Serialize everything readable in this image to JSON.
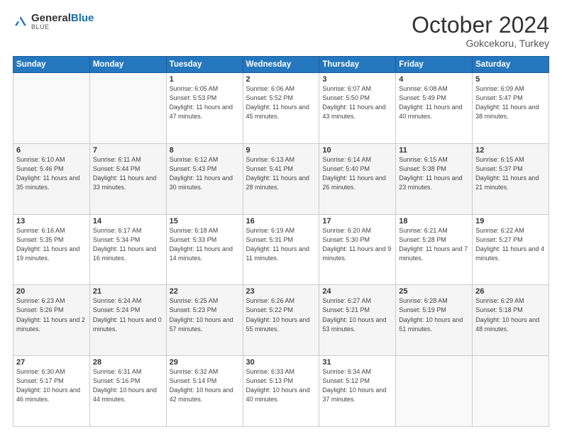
{
  "logo": {
    "general": "General",
    "blue": "Blue"
  },
  "header": {
    "month": "October 2024",
    "location": "Gokcekoru, Turkey"
  },
  "weekdays": [
    "Sunday",
    "Monday",
    "Tuesday",
    "Wednesday",
    "Thursday",
    "Friday",
    "Saturday"
  ],
  "weeks": [
    [
      {
        "day": "",
        "sunrise": "",
        "sunset": "",
        "daylight": ""
      },
      {
        "day": "",
        "sunrise": "",
        "sunset": "",
        "daylight": ""
      },
      {
        "day": "1",
        "sunrise": "Sunrise: 6:05 AM",
        "sunset": "Sunset: 5:53 PM",
        "daylight": "Daylight: 11 hours and 47 minutes."
      },
      {
        "day": "2",
        "sunrise": "Sunrise: 6:06 AM",
        "sunset": "Sunset: 5:52 PM",
        "daylight": "Daylight: 11 hours and 45 minutes."
      },
      {
        "day": "3",
        "sunrise": "Sunrise: 6:07 AM",
        "sunset": "Sunset: 5:50 PM",
        "daylight": "Daylight: 11 hours and 43 minutes."
      },
      {
        "day": "4",
        "sunrise": "Sunrise: 6:08 AM",
        "sunset": "Sunset: 5:49 PM",
        "daylight": "Daylight: 11 hours and 40 minutes."
      },
      {
        "day": "5",
        "sunrise": "Sunrise: 6:09 AM",
        "sunset": "Sunset: 5:47 PM",
        "daylight": "Daylight: 11 hours and 38 minutes."
      }
    ],
    [
      {
        "day": "6",
        "sunrise": "Sunrise: 6:10 AM",
        "sunset": "Sunset: 5:46 PM",
        "daylight": "Daylight: 11 hours and 35 minutes."
      },
      {
        "day": "7",
        "sunrise": "Sunrise: 6:11 AM",
        "sunset": "Sunset: 5:44 PM",
        "daylight": "Daylight: 11 hours and 33 minutes."
      },
      {
        "day": "8",
        "sunrise": "Sunrise: 6:12 AM",
        "sunset": "Sunset: 5:43 PM",
        "daylight": "Daylight: 11 hours and 30 minutes."
      },
      {
        "day": "9",
        "sunrise": "Sunrise: 6:13 AM",
        "sunset": "Sunset: 5:41 PM",
        "daylight": "Daylight: 11 hours and 28 minutes."
      },
      {
        "day": "10",
        "sunrise": "Sunrise: 6:14 AM",
        "sunset": "Sunset: 5:40 PM",
        "daylight": "Daylight: 11 hours and 26 minutes."
      },
      {
        "day": "11",
        "sunrise": "Sunrise: 6:15 AM",
        "sunset": "Sunset: 5:38 PM",
        "daylight": "Daylight: 11 hours and 23 minutes."
      },
      {
        "day": "12",
        "sunrise": "Sunrise: 6:15 AM",
        "sunset": "Sunset: 5:37 PM",
        "daylight": "Daylight: 11 hours and 21 minutes."
      }
    ],
    [
      {
        "day": "13",
        "sunrise": "Sunrise: 6:16 AM",
        "sunset": "Sunset: 5:35 PM",
        "daylight": "Daylight: 11 hours and 19 minutes."
      },
      {
        "day": "14",
        "sunrise": "Sunrise: 6:17 AM",
        "sunset": "Sunset: 5:34 PM",
        "daylight": "Daylight: 11 hours and 16 minutes."
      },
      {
        "day": "15",
        "sunrise": "Sunrise: 6:18 AM",
        "sunset": "Sunset: 5:33 PM",
        "daylight": "Daylight: 11 hours and 14 minutes."
      },
      {
        "day": "16",
        "sunrise": "Sunrise: 6:19 AM",
        "sunset": "Sunset: 5:31 PM",
        "daylight": "Daylight: 11 hours and 11 minutes."
      },
      {
        "day": "17",
        "sunrise": "Sunrise: 6:20 AM",
        "sunset": "Sunset: 5:30 PM",
        "daylight": "Daylight: 11 hours and 9 minutes."
      },
      {
        "day": "18",
        "sunrise": "Sunrise: 6:21 AM",
        "sunset": "Sunset: 5:28 PM",
        "daylight": "Daylight: 11 hours and 7 minutes."
      },
      {
        "day": "19",
        "sunrise": "Sunrise: 6:22 AM",
        "sunset": "Sunset: 5:27 PM",
        "daylight": "Daylight: 11 hours and 4 minutes."
      }
    ],
    [
      {
        "day": "20",
        "sunrise": "Sunrise: 6:23 AM",
        "sunset": "Sunset: 5:26 PM",
        "daylight": "Daylight: 11 hours and 2 minutes."
      },
      {
        "day": "21",
        "sunrise": "Sunrise: 6:24 AM",
        "sunset": "Sunset: 5:24 PM",
        "daylight": "Daylight: 11 hours and 0 minutes."
      },
      {
        "day": "22",
        "sunrise": "Sunrise: 6:25 AM",
        "sunset": "Sunset: 5:23 PM",
        "daylight": "Daylight: 10 hours and 57 minutes."
      },
      {
        "day": "23",
        "sunrise": "Sunrise: 6:26 AM",
        "sunset": "Sunset: 5:22 PM",
        "daylight": "Daylight: 10 hours and 55 minutes."
      },
      {
        "day": "24",
        "sunrise": "Sunrise: 6:27 AM",
        "sunset": "Sunset: 5:21 PM",
        "daylight": "Daylight: 10 hours and 53 minutes."
      },
      {
        "day": "25",
        "sunrise": "Sunrise: 6:28 AM",
        "sunset": "Sunset: 5:19 PM",
        "daylight": "Daylight: 10 hours and 51 minutes."
      },
      {
        "day": "26",
        "sunrise": "Sunrise: 6:29 AM",
        "sunset": "Sunset: 5:18 PM",
        "daylight": "Daylight: 10 hours and 48 minutes."
      }
    ],
    [
      {
        "day": "27",
        "sunrise": "Sunrise: 6:30 AM",
        "sunset": "Sunset: 5:17 PM",
        "daylight": "Daylight: 10 hours and 46 minutes."
      },
      {
        "day": "28",
        "sunrise": "Sunrise: 6:31 AM",
        "sunset": "Sunset: 5:16 PM",
        "daylight": "Daylight: 10 hours and 44 minutes."
      },
      {
        "day": "29",
        "sunrise": "Sunrise: 6:32 AM",
        "sunset": "Sunset: 5:14 PM",
        "daylight": "Daylight: 10 hours and 42 minutes."
      },
      {
        "day": "30",
        "sunrise": "Sunrise: 6:33 AM",
        "sunset": "Sunset: 5:13 PM",
        "daylight": "Daylight: 10 hours and 40 minutes."
      },
      {
        "day": "31",
        "sunrise": "Sunrise: 6:34 AM",
        "sunset": "Sunset: 5:12 PM",
        "daylight": "Daylight: 10 hours and 37 minutes."
      },
      {
        "day": "",
        "sunrise": "",
        "sunset": "",
        "daylight": ""
      },
      {
        "day": "",
        "sunrise": "",
        "sunset": "",
        "daylight": ""
      }
    ]
  ]
}
